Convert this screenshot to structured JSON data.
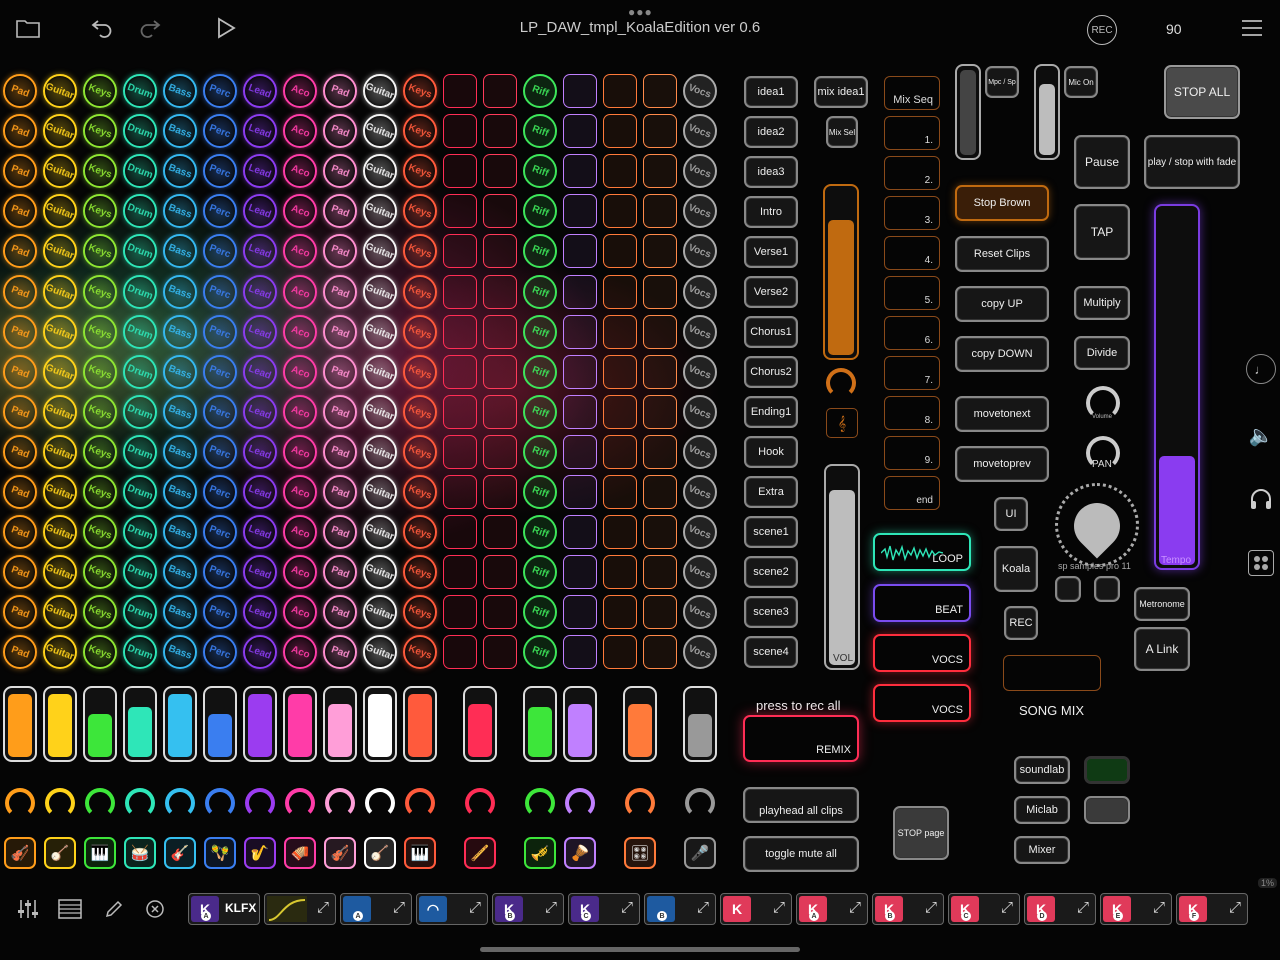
{
  "app": {
    "title": "LP_DAW_tmpl_KoalaEdition ver 0.6",
    "rec_label": "REC",
    "tempo_value": "90"
  },
  "pad_columns": [
    {
      "label": "Pad",
      "color": "#ff9d1a"
    },
    {
      "label": "Guitar",
      "color": "#ffd21a"
    },
    {
      "label": "Keys",
      "color": "#8fe632"
    },
    {
      "label": "Drum",
      "color": "#2ee6b8"
    },
    {
      "label": "Bass",
      "color": "#35b8f0"
    },
    {
      "label": "Perc",
      "color": "#3a7ef0"
    },
    {
      "label": "Lead",
      "color": "#8b3cf0"
    },
    {
      "label": "Aco",
      "color": "#ff3ca8"
    },
    {
      "label": "Pad",
      "color": "#ff8ed0"
    },
    {
      "label": "Guitar",
      "color": "#f4f4f4"
    },
    {
      "label": "Keys",
      "color": "#ff5a3c"
    }
  ],
  "empty_columns": [
    {
      "color": "#ff2d55"
    },
    {
      "color": "#ff3a5a"
    },
    {
      "color": "#c080ff"
    },
    {
      "color": "#ff7a3a"
    },
    {
      "color": "#ff8a4a"
    }
  ],
  "riff_column": {
    "label": "Riff",
    "color": "#3de65a"
  },
  "vocs_column": {
    "label": "Vocs",
    "color": "#aaaaaa"
  },
  "faders": [
    {
      "color": "#ff9d1a",
      "level": 0.95
    },
    {
      "color": "#ffd21a",
      "level": 0.95
    },
    {
      "color": "#3de63a",
      "level": 0.65
    },
    {
      "color": "#2ee6b8",
      "level": 0.75
    },
    {
      "color": "#35c0f0",
      "level": 0.95
    },
    {
      "color": "#3a7ef0",
      "level": 0.65
    },
    {
      "color": "#9b3cf0",
      "level": 0.95
    },
    {
      "color": "#ff3ca8",
      "level": 0.95
    },
    {
      "color": "#ff9ed8",
      "level": 0.8
    },
    {
      "color": "#ffffff",
      "level": 0.95
    },
    {
      "color": "#ff5a3c",
      "level": 0.95
    },
    {
      "color": "#ff2d55",
      "level": 0.8
    },
    {
      "color": "#3de63a",
      "level": 0.75
    },
    {
      "color": "#c080ff",
      "level": 0.8
    },
    {
      "color": "#ff7a3a",
      "level": 0.8
    },
    {
      "color": "#999999",
      "level": 0.65
    }
  ],
  "instrument_icons": [
    "violin-icon",
    "banjo-icon",
    "piano-icon",
    "drum-icon",
    "electric-guitar-icon",
    "maracas-icon",
    "saxophone-icon",
    "accordion-icon",
    "violin-icon",
    "banjo-icon",
    "piano-icon",
    "harmonica-icon",
    "trumpet-icon",
    "cello-icon",
    "drum-machine-icon",
    "microphone-icon"
  ],
  "instrument_glyphs": [
    "🎻",
    "🪕",
    "🎹",
    "🥁",
    "🎸",
    "🪇",
    "🎷",
    "🪗",
    "🎻",
    "🪕",
    "🎹",
    "🪈",
    "🎺",
    "🪘",
    "🎛",
    "🎤"
  ],
  "scene_buttons": [
    "idea1",
    "idea2",
    "idea3",
    "Intro",
    "Verse1",
    "Verse2",
    "Chorus1",
    "Chorus2",
    "Ending1",
    "Hook",
    "Extra",
    "scene1",
    "scene2",
    "scene3",
    "scene4"
  ],
  "mix": {
    "mix_idea_label": "mix idea1",
    "mix_sel_label": "Mix Sel",
    "vol_label": "VOL"
  },
  "mix_seq": {
    "header": "Mix Seq",
    "slots": [
      "1.",
      "2.",
      "3.",
      "4.",
      "5.",
      "6.",
      "7.",
      "8.",
      "9.",
      "end"
    ]
  },
  "clip_controls": {
    "stop_brown": "Stop Brown",
    "reset_clips": "Reset Clips",
    "copy_up": "copy UP",
    "copy_down": "copy DOWN",
    "movetonext": "movetonext",
    "movetoprev": "movetoprev"
  },
  "transport": {
    "mpc_sp": "Mpc / Sp",
    "mic_on": "Mic On",
    "stop_all": "STOP ALL",
    "pause": "Pause",
    "play_stop_fade": "play / stop with fade",
    "tap": "TAP",
    "multiply": "Multiply",
    "divide": "Divide",
    "volume": "Volume",
    "pan": "PAN",
    "tempo": "Tempo",
    "metronome": "Metronome",
    "a_link": "A Link",
    "sp_samples": "sp samples pro 11"
  },
  "loops": {
    "loop": "LOOP",
    "beat": "BEAT",
    "vocs1": "VOCS",
    "vocs2": "VOCS"
  },
  "misc": {
    "ui": "UI",
    "koala": "Koala",
    "rec": "REC",
    "song_mix": "SONG MIX",
    "press_to_rec_all": "press to rec all",
    "remix": "REMIX",
    "playhead_all_clips": "playhead all clips",
    "toggle_mute_all": "toggle mute all",
    "stop_page": "STOP page",
    "soundlab": "soundlab",
    "miclab": "Miclab",
    "mixer": "Mixer"
  },
  "bottom": {
    "klfx_label": "KLFX",
    "zoom": "1%"
  }
}
